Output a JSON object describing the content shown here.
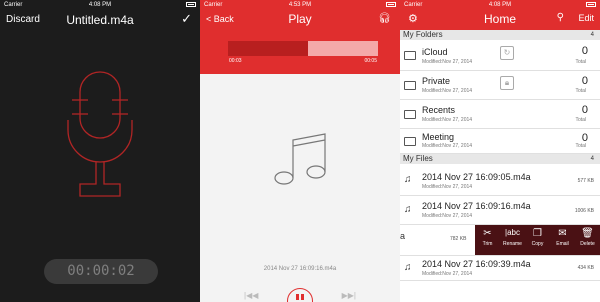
{
  "recorder": {
    "status": {
      "carrier": "Carrier",
      "time": "4:08 PM"
    },
    "discard_label": "Discard",
    "title": "Untitled.m4a",
    "timer": "00:00:02",
    "icons": {
      "confirm": "checkmark-icon",
      "mic": "microphone-icon"
    }
  },
  "player": {
    "status": {
      "carrier": "Carrier",
      "time": "4:53 PM"
    },
    "back_label": "Back",
    "title": "Play",
    "elapsed": "00:03",
    "duration": "00:05",
    "progress": 0.53,
    "file_name": "2014 Nov 27 16:09:16.m4a",
    "icons": {
      "headphones": "headphones-icon",
      "note": "music-note-icon",
      "pause": "pause-icon"
    },
    "accent": "#e02e2e"
  },
  "home": {
    "status": {
      "carrier": "Carrier",
      "time": "4:08 PM"
    },
    "title": "Home",
    "edit_label": "Edit",
    "folders_header": "My Folders",
    "folders_count": "4",
    "folders": [
      {
        "name": "iCloud",
        "modified": "Modified:Nov 27, 2014",
        "count": "0",
        "total": "Total"
      },
      {
        "name": "Private",
        "modified": "Modified:Nov 27, 2014",
        "count": "0",
        "total": "Total"
      },
      {
        "name": "Recents",
        "modified": "Modified:Nov 27, 2014",
        "count": "0",
        "total": "Total"
      },
      {
        "name": "Meeting",
        "modified": "Modified:Nov 27, 2014",
        "count": "0",
        "total": "Total"
      }
    ],
    "files_header": "My Files",
    "files_count": "4",
    "files": [
      {
        "name": "2014 Nov 27 16:09:05.m4a",
        "modified": "Modified:Nov 27, 2014",
        "size": "577 KB"
      },
      {
        "name": "2014 Nov 27 16:09:16.m4a",
        "modified": "Modified:Nov 27, 2014",
        "size": "1006 KB"
      },
      {
        "name": "2014 Nov 27 16:09:39.m4a",
        "modified": "Modified:Nov 27, 2014",
        "size": "434 KB"
      }
    ],
    "swiped_row": {
      "name_fragment": "a",
      "size": "782 KB"
    },
    "actions": [
      {
        "label": "Trim",
        "icon": "scissors-icon"
      },
      {
        "label": "Rename",
        "icon": "rename-icon"
      },
      {
        "label": "Copy",
        "icon": "copy-icon"
      },
      {
        "label": "Email",
        "icon": "envelope-icon"
      },
      {
        "label": "Delete",
        "icon": "trash-icon"
      }
    ],
    "accent": "#e02e2e"
  }
}
